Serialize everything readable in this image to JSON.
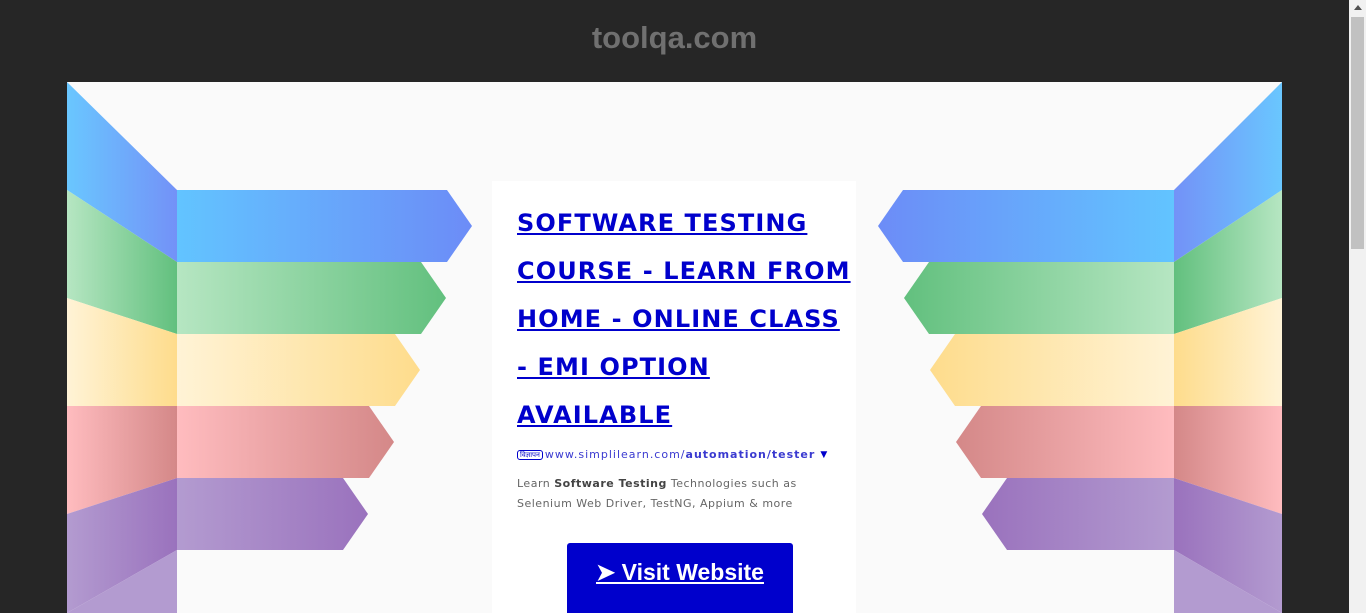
{
  "site": {
    "title": "toolqa.com"
  },
  "ad": {
    "headline": "SOFTWARE TESTING COURSE - LEARN FROM HOME - ONLINE CLASS - EMI OPTION AVAILABLE",
    "badge": "विज्ञापन",
    "url_prefix": "www.simplilearn.com/",
    "url_path": "automation/tester",
    "caret": "▼",
    "desc_before": "Learn ",
    "desc_bold": "Software Testing",
    "desc_after": " Technologies such as Selenium Web Driver, TestNG, Appium & more",
    "button_label": "➤ Visit Website"
  },
  "colors": {
    "ad_link": "#0000cc",
    "stripe_blue": "#6a9cfb",
    "stripe_green": "#78c98a",
    "stripe_yellow": "#fde3a4",
    "stripe_red": "#e9a0a2",
    "stripe_purple": "#a48dc4"
  }
}
